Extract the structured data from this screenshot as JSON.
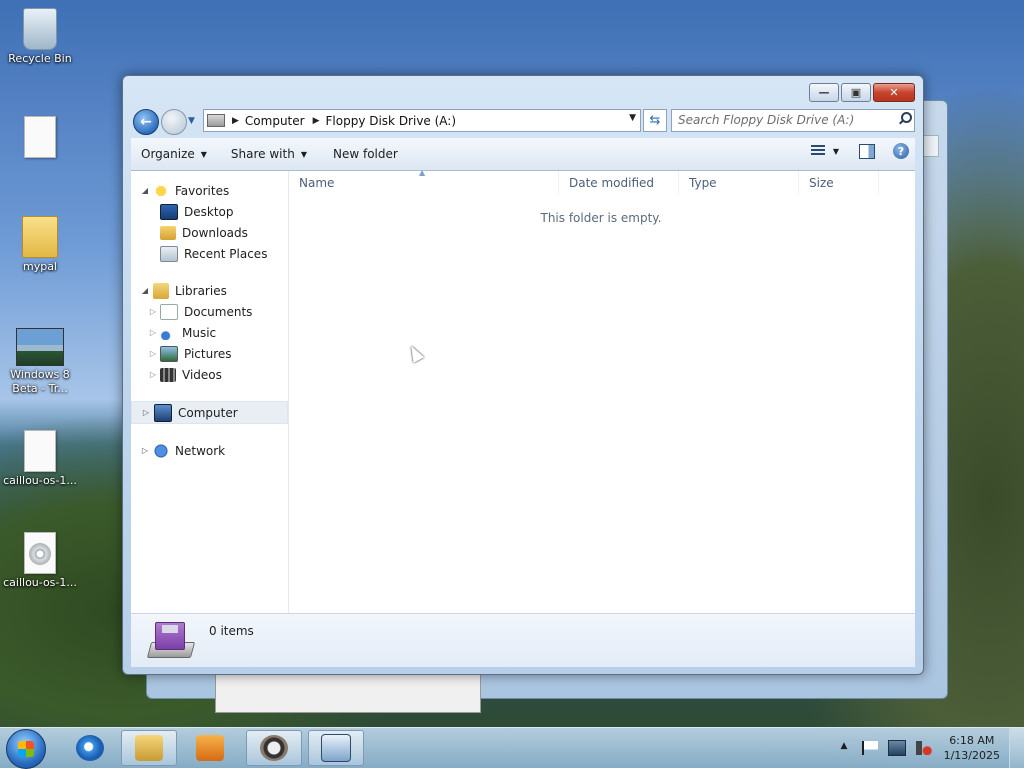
{
  "desktop": {
    "icons": [
      {
        "label": "Recycle Bin",
        "kind": "recycle-bin-icon"
      },
      {
        "label": "",
        "kind": "document-icon"
      },
      {
        "label": "mypal",
        "kind": "folder-icon"
      },
      {
        "label": "Windows 8 Beta - Tr...",
        "kind": "image-icon"
      },
      {
        "label": "caillou-os-1...",
        "kind": "document-icon"
      },
      {
        "label": "caillou-os-1...",
        "kind": "disc-image-icon"
      }
    ]
  },
  "window": {
    "address": {
      "crumbs": [
        "Computer",
        "Floppy Disk Drive (A:)"
      ]
    },
    "search": {
      "placeholder": "Search Floppy Disk Drive (A:)"
    },
    "toolbar": {
      "organize": "Organize",
      "share_with": "Share with",
      "new_folder": "New folder"
    },
    "nav": {
      "favorites": {
        "label": "Favorites",
        "items": [
          "Desktop",
          "Downloads",
          "Recent Places"
        ]
      },
      "libraries": {
        "label": "Libraries",
        "items": [
          "Documents",
          "Music",
          "Pictures",
          "Videos"
        ]
      },
      "computer": "Computer",
      "network": "Network"
    },
    "columns": [
      "Name",
      "Date modified",
      "Type",
      "Size"
    ],
    "empty_message": "This folder is empty.",
    "details": {
      "item_count": "0 items"
    }
  },
  "taskbar": {
    "items": [
      {
        "name": "internet-explorer-icon",
        "active": false
      },
      {
        "name": "file-explorer-icon",
        "active": true
      },
      {
        "name": "media-player-icon",
        "active": false
      },
      {
        "name": "raccoon-app-icon",
        "active": true
      },
      {
        "name": "window-app-icon",
        "active": true
      }
    ],
    "tray": [
      "show-hidden-icons-arrow",
      "action-center-flag-icon",
      "network-icon",
      "volume-muted-icon"
    ],
    "clock": {
      "time": "6:18 AM",
      "date": "1/13/2025"
    }
  }
}
